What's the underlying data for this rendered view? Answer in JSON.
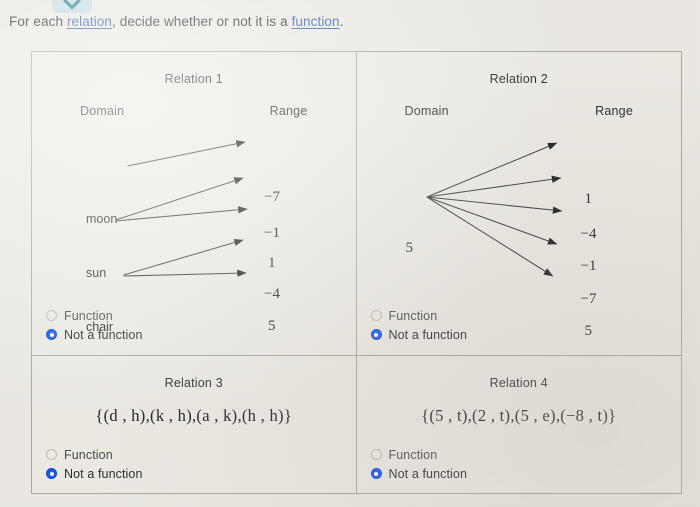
{
  "top_control": {
    "icon": "chevron-down-icon"
  },
  "prompt": {
    "before": "For each ",
    "link1": "relation",
    "middle": ", decide whether or not it is a ",
    "link2": "function",
    "after": "."
  },
  "radio_options": {
    "function": "Function",
    "not_a_function": "Not a function"
  },
  "relations": [
    {
      "title": "Relation 1",
      "type": "mapping",
      "domain_heading": "Domain",
      "range_heading": "Range",
      "domain": [
        "moon",
        "sun",
        "chair"
      ],
      "range": [
        "−7",
        "−1",
        "1",
        "−4",
        "5"
      ],
      "pairs": [
        {
          "from": "moon",
          "to": "−7"
        },
        {
          "from": "sun",
          "to": "−1"
        },
        {
          "from": "sun",
          "to": "1"
        },
        {
          "from": "chair",
          "to": "−4"
        },
        {
          "from": "chair",
          "to": "5"
        }
      ],
      "selected": "not_a_function"
    },
    {
      "title": "Relation 2",
      "type": "mapping",
      "domain_heading": "Domain",
      "range_heading": "Range",
      "domain": [
        "5"
      ],
      "range": [
        "1",
        "−4",
        "−1",
        "−7",
        "5"
      ],
      "pairs": [
        {
          "from": "5",
          "to": "1"
        },
        {
          "from": "5",
          "to": "−4"
        },
        {
          "from": "5",
          "to": "−1"
        },
        {
          "from": "5",
          "to": "−7"
        },
        {
          "from": "5",
          "to": "5"
        }
      ],
      "selected": "not_a_function"
    },
    {
      "title": "Relation 3",
      "type": "set",
      "set": "{(d , h),(k , h),(a , k),(h , h)}",
      "set_pairs": [
        [
          "d",
          "h"
        ],
        [
          "k",
          "h"
        ],
        [
          "a",
          "k"
        ],
        [
          "h",
          "h"
        ]
      ],
      "selected": "not_a_function"
    },
    {
      "title": "Relation 4",
      "type": "set",
      "set": "{(5 , t),(2 , t),(5 , e),(−8 , t)}",
      "set_pairs": [
        [
          "5",
          "t"
        ],
        [
          "2",
          "t"
        ],
        [
          "5",
          "e"
        ],
        [
          "−8",
          "t"
        ]
      ],
      "selected": "not_a_function"
    }
  ],
  "colors": {
    "page_background": "#eceae3",
    "table_border": "#a9a69d",
    "link": "#2f5fa8",
    "radio_selected": "#1358ef",
    "pill": "#c3dde4",
    "text": "#2b2b2b"
  }
}
